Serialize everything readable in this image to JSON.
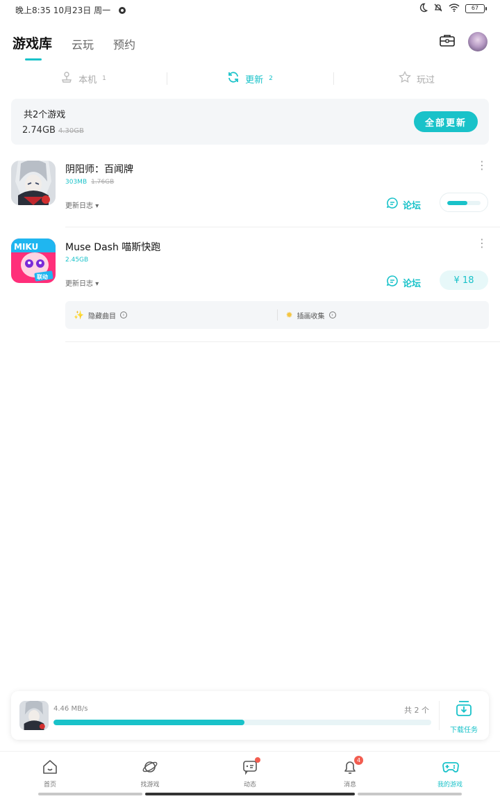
{
  "status_bar": {
    "time": "晚上8:35 10月23日 周一",
    "battery": "67"
  },
  "header": {
    "tabs": [
      {
        "label": "游戏库",
        "active": true
      },
      {
        "label": "云玩",
        "active": false
      },
      {
        "label": "预约",
        "active": false
      }
    ],
    "icons": [
      "toolbox-icon",
      "avatar"
    ]
  },
  "sub_tabs": [
    {
      "label": "本机",
      "count": "1",
      "icon": "joystick-icon",
      "active": false
    },
    {
      "label": "更新",
      "count": "2",
      "icon": "refresh-icon",
      "active": true
    },
    {
      "label": "玩过",
      "count": "",
      "icon": "star-icon",
      "active": false
    }
  ],
  "summary": {
    "title": "共2个游戏",
    "size": "2.74GB",
    "old_size": "4.30GB",
    "update_all_label": "全部更新"
  },
  "games": [
    {
      "name": "阴阳师：百闻牌",
      "size": "303MB",
      "old_size": "1.76GB",
      "changelog": "更新日志",
      "forum": "论坛",
      "progress": 0.6
    },
    {
      "name": "Muse Dash 喵斯快跑",
      "size": "2.45GB",
      "changelog": "更新日志",
      "forum": "论坛",
      "price": "¥ 18",
      "extras": [
        "隐藏曲目",
        "插画收集"
      ]
    }
  ],
  "download": {
    "speed": "4.46 MB/s",
    "count": "共 2 个",
    "progress": 0.505,
    "task_label": "下载任务"
  },
  "bottom_nav": [
    {
      "label": "首页",
      "icon": "home-icon"
    },
    {
      "label": "找游戏",
      "icon": "planet-icon"
    },
    {
      "label": "动态",
      "icon": "message-icon",
      "dot": true
    },
    {
      "label": "消息",
      "icon": "bell-icon",
      "badge": "4"
    },
    {
      "label": "我的游戏",
      "icon": "gamepad-icon",
      "active": true
    }
  ],
  "colors": {
    "accent": "#19c2c9",
    "badge": "#f25d50"
  }
}
